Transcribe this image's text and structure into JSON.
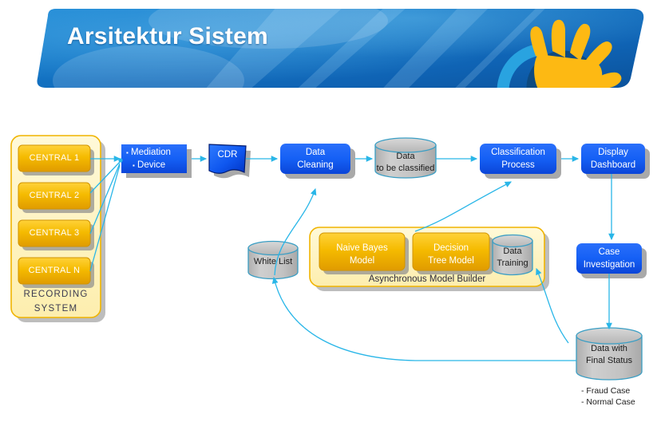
{
  "header": {
    "title": "Arsitektur Sistem",
    "logo_icon": "hand-sun-logo-icon",
    "banner_color": "#1878c8",
    "banner_color_dark": "#0b5ba6",
    "logo_hand_color": "#fdb913",
    "logo_arc_color": "#0d4a80",
    "logo_arc_light_color": "#29a3e0"
  },
  "colors": {
    "blue_box": "#1560f5",
    "blue_box_dark": "#0b3fd0",
    "gold_box": "#f0b400",
    "gold_box_dark": "#d99a00",
    "pale_yellow": "#fdf3c0",
    "pale_yellow_border": "#f0b400",
    "cylinder_fill": "#c0c0c0",
    "cylinder_stroke": "#3a9ec4",
    "arrow": "#29b6e8",
    "shadow": "#8c8c8c"
  },
  "diagram": {
    "recording_system": {
      "label_line1": "RECORDING",
      "label_line2": "SYSTEM",
      "centrals": [
        {
          "label": "CENTRAL 1"
        },
        {
          "label": "CENTRAL 2"
        },
        {
          "label": "CENTRAL 3"
        },
        {
          "label": "CENTRAL N"
        }
      ]
    },
    "mediation_device": {
      "line1": "Mediation",
      "line2": "Device"
    },
    "cdr": {
      "label": "CDR"
    },
    "data_cleaning": {
      "line1": "Data",
      "line2": "Cleaning"
    },
    "data_to_be_classified": {
      "line1": "Data",
      "line2": "to be classified"
    },
    "classification_process": {
      "line1": "Classification",
      "line2": "Process"
    },
    "display_dashboard": {
      "line1": "Display",
      "line2": "Dashboard"
    },
    "case_investigation": {
      "line1": "Case",
      "line2": "Investigation"
    },
    "white_list": {
      "label": "White List"
    },
    "async_model_builder": {
      "title": "Asynchronous Model Builder",
      "naive_bayes": {
        "line1": "Naive Bayes",
        "line2": "Model"
      },
      "decision_tree": {
        "line1": "Decision",
        "line2": "Tree Model"
      },
      "data_training": {
        "line1": "Data",
        "line2": "Training"
      }
    },
    "data_final_status": {
      "line1": "Data with",
      "line2": "Final Status"
    },
    "legend": {
      "line1": "- Fraud Case",
      "line2": "- Normal Case"
    }
  }
}
